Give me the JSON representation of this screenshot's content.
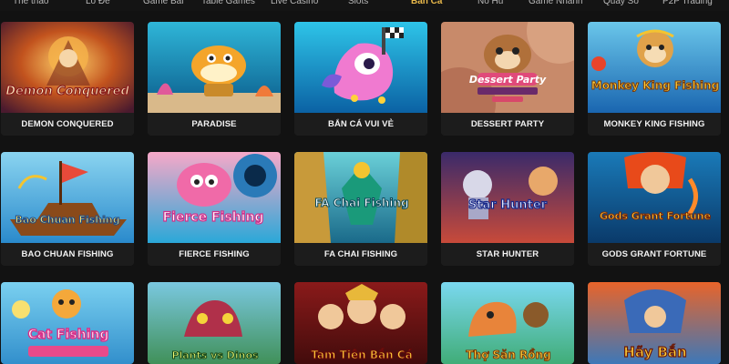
{
  "nav": {
    "items": [
      {
        "label": "Thể thao",
        "active": false
      },
      {
        "label": "Lô Đề",
        "active": false
      },
      {
        "label": "Game Bài",
        "active": false
      },
      {
        "label": "Table Games",
        "active": false
      },
      {
        "label": "Live Casino",
        "active": false
      },
      {
        "label": "Slots",
        "active": false
      },
      {
        "label": "Bắn Cá",
        "active": true
      },
      {
        "label": "Nổ Hũ",
        "active": false
      },
      {
        "label": "Game Nhanh",
        "active": false
      },
      {
        "label": "Quay Số",
        "active": false
      },
      {
        "label": "P2P Trading",
        "active": false
      }
    ]
  },
  "games": [
    {
      "title": "DEMON CONQUERED",
      "art": "Demon Conquered"
    },
    {
      "title": "PARADISE",
      "art": ""
    },
    {
      "title": "BẮN CÁ VUI VẺ",
      "art": ""
    },
    {
      "title": "DESSERT PARTY",
      "art": "Dessert Party"
    },
    {
      "title": "MONKEY KING FISHING",
      "art": "Monkey King Fishing"
    },
    {
      "title": "BAO CHUAN FISHING",
      "art": "Bao Chuan Fishing"
    },
    {
      "title": "FIERCE FISHING",
      "art": "Fierce Fishing"
    },
    {
      "title": "FA CHAI FISHING",
      "art": "FA Chai Fishing"
    },
    {
      "title": "STAR HUNTER",
      "art": "Star Hunter"
    },
    {
      "title": "GODS GRANT FORTUNE",
      "art": "Gods Grant Fortune"
    },
    {
      "title": "",
      "art": "Cat Fishing"
    },
    {
      "title": "",
      "art": "Plants vs Dinos"
    },
    {
      "title": "",
      "art": "Tam Tiên Bắn Cá"
    },
    {
      "title": "",
      "art": "Thợ Săn Rồng"
    },
    {
      "title": "",
      "art": "Hãy Bắn"
    }
  ],
  "colors": {
    "background": "#121212",
    "card": "#1c1c1c",
    "accent": "#e8b84a",
    "nav_text": "#b8b8b8"
  }
}
